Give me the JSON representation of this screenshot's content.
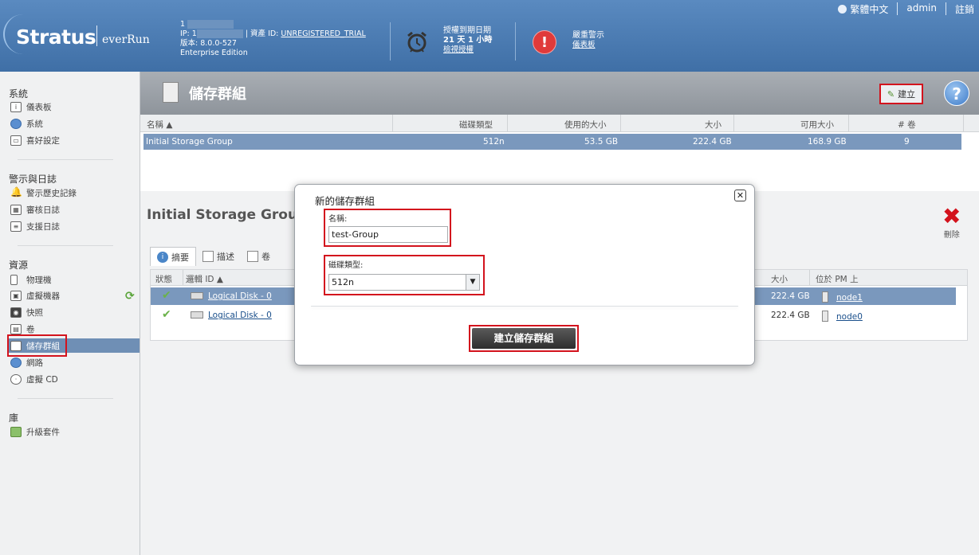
{
  "header": {
    "brand": "Stratus",
    "product": "everRun",
    "host_line": "1",
    "ip_label": "IP: 1",
    "asset_label": "| 資產 ID:",
    "asset_value": "UNREGISTERED_TRIAL",
    "version": "版本: 8.0.0-527",
    "edition": "Enterprise Edition",
    "license_title": "授權到期日期",
    "license_remaining": "21 天 1 小時",
    "license_link": "檢視授權",
    "alert_title": "嚴重警示",
    "alert_link": "儀表板",
    "language": "繁體中文",
    "user": "admin",
    "logout": "註銷"
  },
  "sidebar": {
    "system_title": "系統",
    "system_items": [
      "儀表板",
      "系統",
      "喜好設定"
    ],
    "alerts_title": "警示與日誌",
    "alerts_items": [
      "警示歷史記錄",
      "審核日誌",
      "支援日誌"
    ],
    "resources_title": "資源",
    "resources_items": [
      "物理機",
      "虛擬機器",
      "快照",
      "卷",
      "儲存群組",
      "網路",
      "虛擬 CD"
    ],
    "library_title": "庫",
    "library_items": [
      "升級套件"
    ],
    "active_item": "儲存群組"
  },
  "page": {
    "title": "儲存群組",
    "create_label": "建立",
    "help_label": "?"
  },
  "storage_table": {
    "columns": [
      "名稱 ▲",
      "磁碟類型",
      "使用的大小",
      "大小",
      "可用大小",
      "# 卷"
    ],
    "rows": [
      {
        "name": "Initial Storage Group",
        "disk_type": "512n",
        "used": "53.5 GB",
        "size": "222.4 GB",
        "free": "168.9 GB",
        "volumes": "9"
      }
    ]
  },
  "detail": {
    "title": "Initial Storage Group",
    "delete_label": "刪除",
    "tabs": [
      "摘要",
      "描述",
      "卷"
    ],
    "columns": [
      "狀態",
      "邏輯 ID ▲",
      "大小",
      "位於 PM 上"
    ],
    "rows": [
      {
        "status": "✔",
        "id": "Logical Disk - 0",
        "size": "222.4 GB",
        "pm": "node1"
      },
      {
        "status": "✔",
        "id": "Logical Disk - 0",
        "size": "222.4 GB",
        "pm": "node0"
      }
    ]
  },
  "dialog": {
    "title": "新的儲存群組",
    "name_label": "名稱:",
    "name_value": "test-Group",
    "disk_type_label": "磁碟類型:",
    "disk_type_value": "512n",
    "submit_label": "建立儲存群組",
    "close_label": "✕"
  },
  "colors": {
    "header_bg": "#4a7bb3",
    "highlight": "#d3131d",
    "selected_row": "#7a98bd"
  }
}
